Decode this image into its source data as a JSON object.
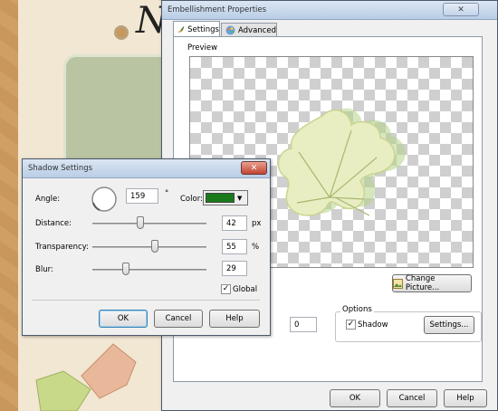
{
  "embellishment": {
    "title": "Embellishment Properties",
    "tabs": [
      {
        "label": "Settings"
      },
      {
        "label": "Advanced"
      }
    ],
    "preview_label": "Preview",
    "change_picture": "Change Picture...",
    "hidden_value": "0",
    "options_label": "Options",
    "shadow_label": "Shadow",
    "shadow_checked": true,
    "settings_button": "Settings...",
    "ok": "OK",
    "cancel": "Cancel",
    "help": "Help"
  },
  "shadow": {
    "title": "Shadow Settings",
    "angle_label": "Angle:",
    "angle_value": "159",
    "degree_sign": "°",
    "color_label": "Color:",
    "color_value": "#1a7a1a",
    "distance_label": "Distance:",
    "distance_value": "42",
    "distance_unit": "px",
    "distance_level": 0.42,
    "transparency_label": "Transparency:",
    "transparency_value": "55",
    "transparency_unit": "%",
    "transparency_level": 0.55,
    "blur_label": "Blur:",
    "blur_value": "29",
    "blur_level": 0.29,
    "global_label": "Global",
    "global_checked": true,
    "ok": "OK",
    "cancel": "Cancel",
    "help": "Help"
  },
  "background": {
    "letter": "N"
  }
}
